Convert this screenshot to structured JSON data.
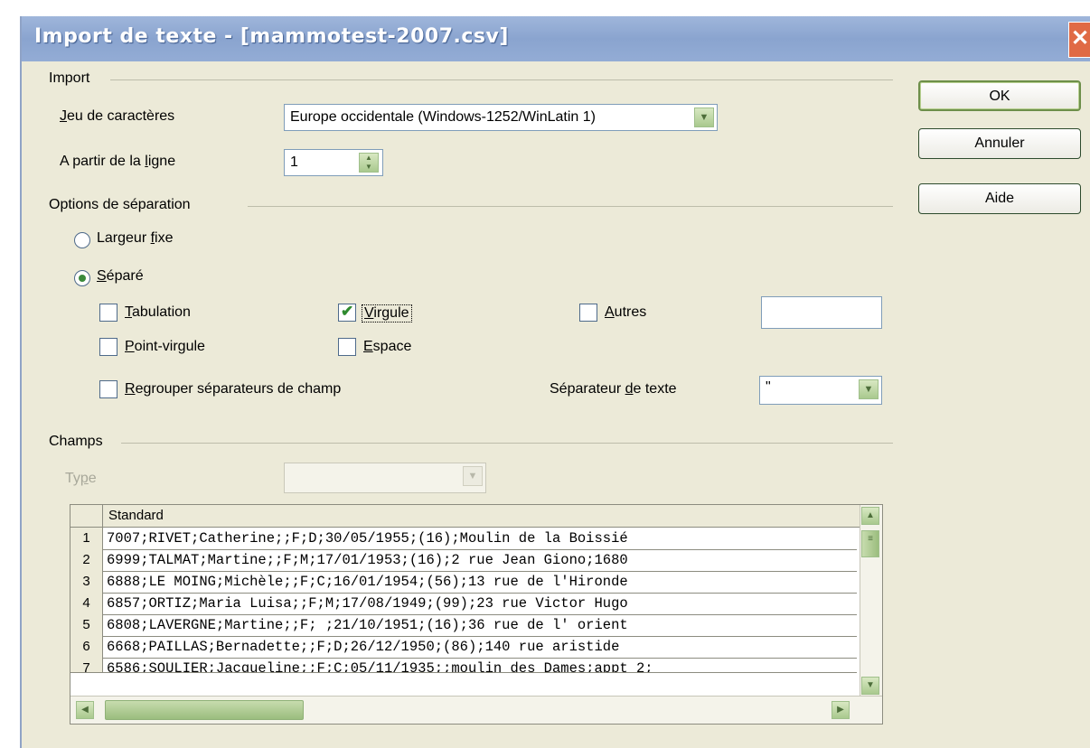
{
  "window": {
    "title": "Import de texte - [mammotest-2007.csv]",
    "close_glyph": "✕"
  },
  "import_section": {
    "label": "Import",
    "charset_label_u": "J",
    "charset_label_rest": "eu de caractères",
    "charset_value": "Europe occidentale (Windows-1252/WinLatin 1)",
    "from_line_label_a": "A partir de la ",
    "from_line_label_u": "l",
    "from_line_label_b": "igne",
    "from_line_value": "1"
  },
  "separation_section": {
    "label": "Options de séparation",
    "fixed_width_a": "Largeur ",
    "fixed_width_u": "f",
    "fixed_width_b": "ixe",
    "fixed_width_selected": false,
    "separated_u": "S",
    "separated_b": "éparé",
    "separated_selected": true,
    "tab_u": "T",
    "tab_b": "abulation",
    "tab_checked": false,
    "comma_u": "V",
    "comma_b": "irgule",
    "comma_checked": true,
    "others_u": "A",
    "others_b": "utres",
    "others_checked": false,
    "others_value": "",
    "semicolon_u": "P",
    "semicolon_b": "oint-virgule",
    "semicolon_checked": false,
    "space_u": "E",
    "space_b": "space",
    "space_checked": false,
    "merge_u": "R",
    "merge_b": "egrouper séparateurs de champ",
    "merge_checked": false,
    "text_sep_label_a": "Séparateur ",
    "text_sep_label_u": "d",
    "text_sep_label_b": "e texte",
    "text_sep_value": "\""
  },
  "fields_section": {
    "label": "Champs",
    "type_label_a": "Ty",
    "type_label_u": "p",
    "type_label_b": "e",
    "column_header": "Standard",
    "rows": [
      {
        "num": "1",
        "text": "7007;RIVET;Catherine;;F;D;30/05/1955;(16);Moulin de la Boissié"
      },
      {
        "num": "2",
        "text": "6999;TALMAT;Martine;;F;M;17/01/1953;(16);2 rue Jean Giono;1680"
      },
      {
        "num": "3",
        "text": "6888;LE MOING;Michèle;;F;C;16/01/1954;(56);13 rue de l'Hironde"
      },
      {
        "num": "4",
        "text": "6857;ORTIZ;Maria Luisa;;F;M;17/08/1949;(99);23 rue Victor Hugo"
      },
      {
        "num": "5",
        "text": "6808;LAVERGNE;Martine;;F; ;21/10/1951;(16);36 rue de l' orient"
      },
      {
        "num": "6",
        "text": "6668;PAILLAS;Bernadette;;F;D;26/12/1950;(86);140 rue aristide"
      },
      {
        "num": "7",
        "text": "6586;SOULIER;Jacqueline;;F;C;05/11/1935;;moulin des Dames;appt 2;"
      }
    ]
  },
  "buttons": {
    "ok": "OK",
    "cancel": "Annuler",
    "help": "Aide"
  }
}
